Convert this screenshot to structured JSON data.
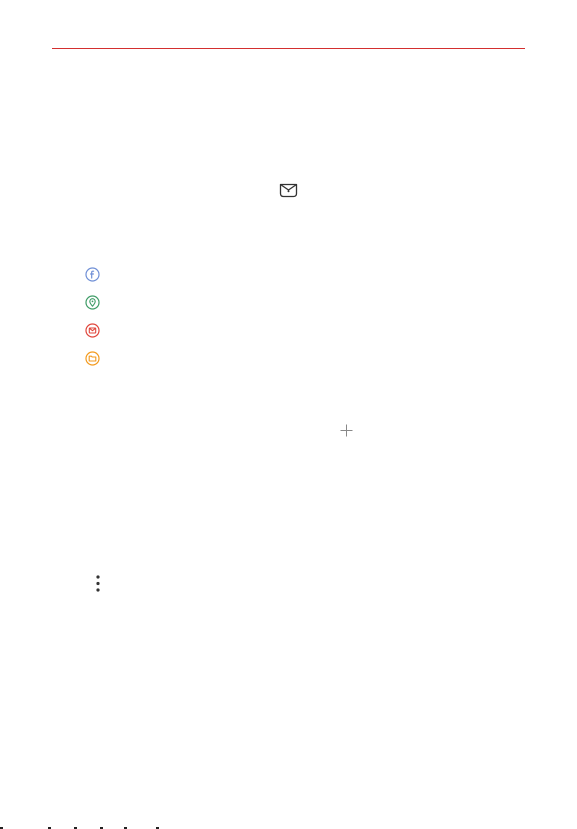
{
  "colors": {
    "rule": "#d32f2f",
    "facebook": "#6f8fd6",
    "location": "#3f9c67",
    "email": "#e0463c",
    "folder": "#f39a1d",
    "ink": "#333333",
    "plus": "#888888"
  },
  "icons": {
    "header": "capsule-icon",
    "list": [
      "facebook-icon",
      "location-icon",
      "email-icon",
      "folder-icon"
    ],
    "add": "plus-icon",
    "menu": "more-options-icon"
  }
}
